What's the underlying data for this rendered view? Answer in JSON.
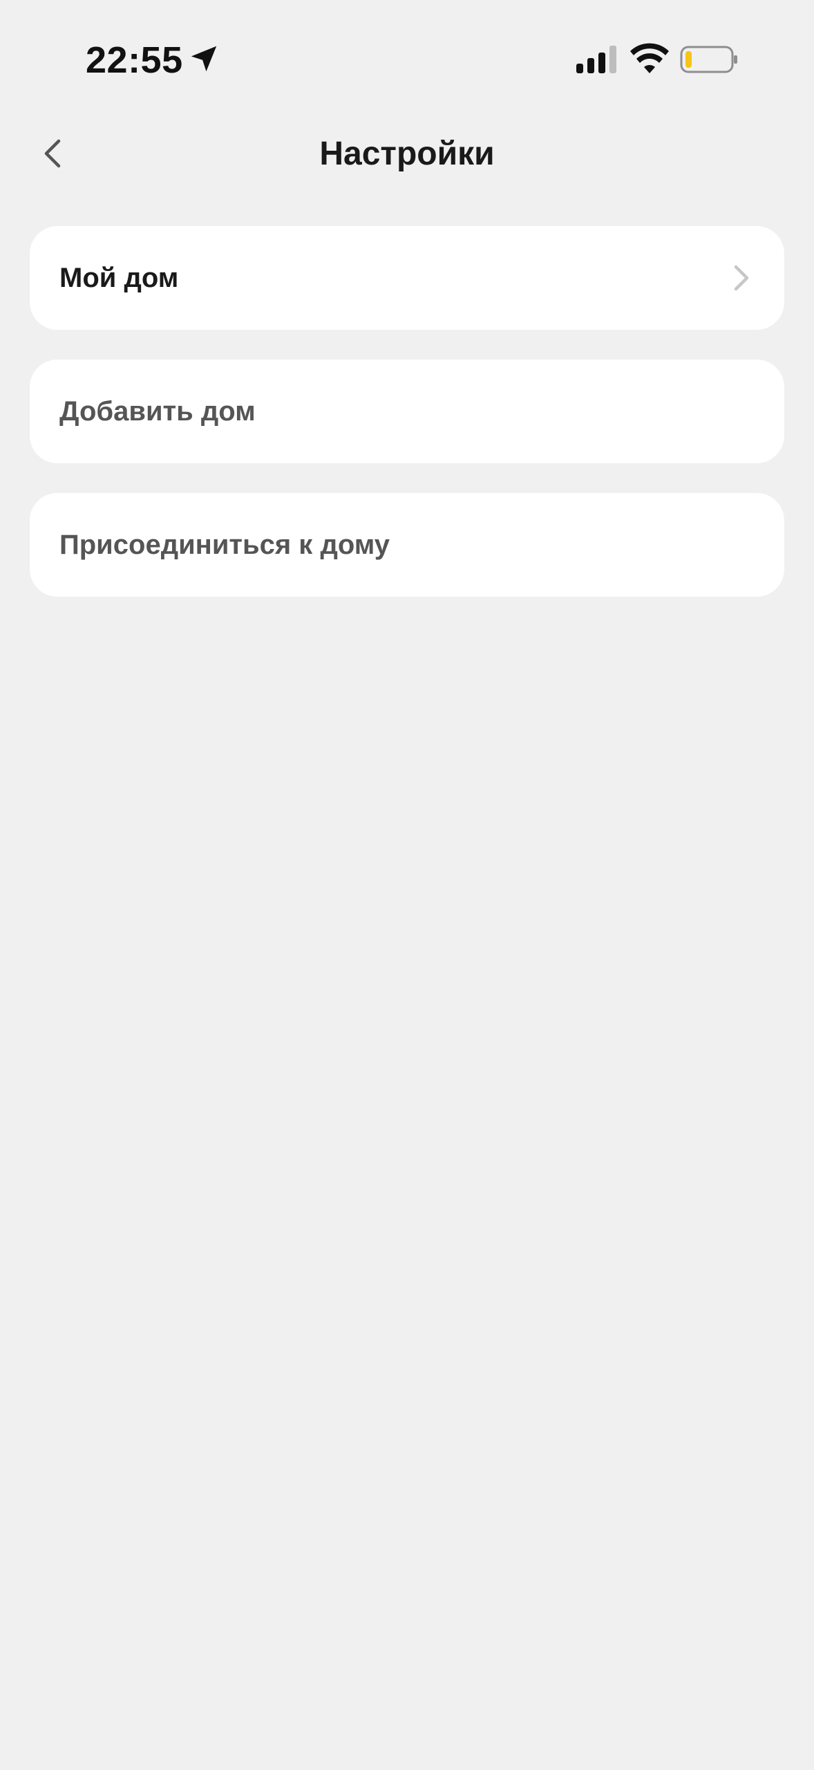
{
  "status_bar": {
    "time": "22:55",
    "icons": [
      "location-arrow-icon",
      "cellular-signal-icon",
      "wifi-icon",
      "battery-low-icon"
    ],
    "battery_color": "#f5c518"
  },
  "header": {
    "title": "Настройки",
    "back_icon": "chevron-left-icon"
  },
  "menu": {
    "items": [
      {
        "label": "Мой дом",
        "has_chevron": true
      },
      {
        "label": "Добавить дом",
        "has_chevron": false
      },
      {
        "label": "Присоединиться к дому",
        "has_chevron": false
      }
    ]
  },
  "colors": {
    "background": "#f0f0f0",
    "card": "#ffffff",
    "text_primary": "#1a1a1a",
    "text_secondary": "#555555",
    "chevron": "#c7c7c7"
  }
}
